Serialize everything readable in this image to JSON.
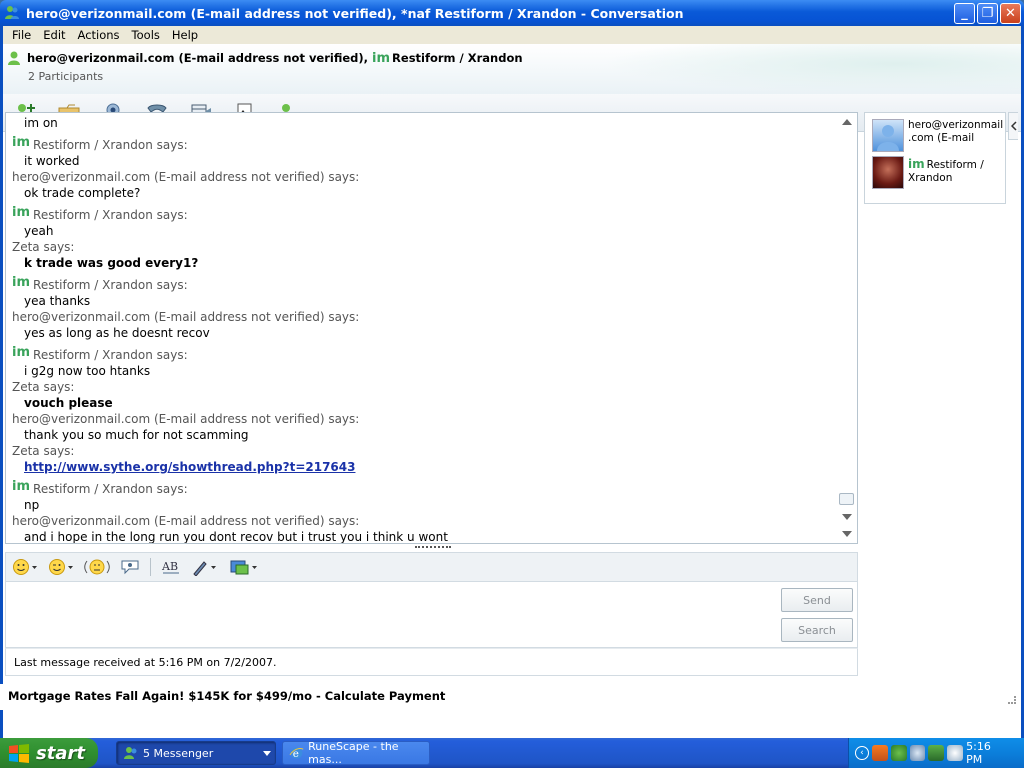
{
  "window": {
    "title": "hero@verizonmail.com (E-mail address not verified), *naf Restiform / Xrandon - Conversation",
    "minimize_icon": "minimize-icon",
    "maximize_icon": "restore-icon",
    "close_icon": "close-icon"
  },
  "menu": [
    "File",
    "Edit",
    "Actions",
    "Tools",
    "Help"
  ],
  "header": {
    "contact1": "hero@verizonmail.com (E-mail address not verified),",
    "contact2": "Restiform / Xrandon",
    "participants": "2 Participants"
  },
  "toolbar": {
    "icons": [
      "invite-contact-icon",
      "share-files-icon",
      "video-call-icon",
      "phone-call-icon",
      "video-icon",
      "games-icon",
      "block-icon"
    ]
  },
  "messages": [
    {
      "text": "im on",
      "bold": false
    },
    {
      "sender": "Restiform / Xrandon says:",
      "im": true
    },
    {
      "text": "it worked",
      "bold": false
    },
    {
      "sender": "hero@verizonmail.com (E-mail address not verified) says:",
      "im": false
    },
    {
      "text": "ok trade complete?",
      "bold": false
    },
    {
      "sender": "Restiform / Xrandon says:",
      "im": true
    },
    {
      "text": "yeah",
      "bold": false
    },
    {
      "sender": "Zeta says:",
      "im": false
    },
    {
      "text": "k trade was good every1?",
      "bold": true
    },
    {
      "sender": "Restiform / Xrandon says:",
      "im": true
    },
    {
      "text": "yea thanks",
      "bold": false
    },
    {
      "sender": "hero@verizonmail.com (E-mail address not verified) says:",
      "im": false
    },
    {
      "text": "yes as long as he doesnt recov",
      "bold": false
    },
    {
      "sender": "Restiform / Xrandon says:",
      "im": true
    },
    {
      "text": "i g2g now too htanks",
      "bold": false
    },
    {
      "sender": "Zeta says:",
      "im": false
    },
    {
      "text": "vouch please",
      "bold": true
    },
    {
      "sender": "hero@verizonmail.com (E-mail address not verified) says:",
      "im": false
    },
    {
      "text": "thank you so much for not scamming",
      "bold": false
    },
    {
      "sender": "Zeta says:",
      "im": false
    },
    {
      "link": "http://www.sythe.org/showthread.php?t=217643"
    },
    {
      "sender": "Restiform / Xrandon says:",
      "im": true
    },
    {
      "text": "np",
      "bold": false
    },
    {
      "sender": "hero@verizonmail.com (E-mail address not verified) says:",
      "im": false
    },
    {
      "text": "and i hope in the long run you dont recov but i trust you i think u wont",
      "bold": false
    }
  ],
  "format_bar": {
    "icons": [
      "emoticon-icon",
      "wink-icon",
      "nudge-icon",
      "voice-clip-icon",
      "font-icon",
      "color-icon",
      "background-icon"
    ]
  },
  "buttons": {
    "send": "Send",
    "search": "Search"
  },
  "status": "Last message received at 5:16 PM on 7/2/2007.",
  "ad": "Mortgage Rates Fall Again! $145K for $499/mo - Calculate Payment",
  "roster": [
    {
      "name_line1": "hero@verizonmail",
      "name_line2": ".com (E-mail",
      "avatar": "default-avatar"
    },
    {
      "name_line1": "Restiform /",
      "name_line2": "Xrandon",
      "avatar": "photo-avatar"
    }
  ],
  "taskbar": {
    "start": "start",
    "tasks": [
      {
        "label": "5 Messenger",
        "active": true
      },
      {
        "label": "RuneScape - the mas...",
        "active": false
      }
    ],
    "clock": "5:16 PM"
  },
  "colors": {
    "title_blue": "#0a5ad8",
    "link": "#1a32a8",
    "start_green": "#2f8f2f"
  }
}
